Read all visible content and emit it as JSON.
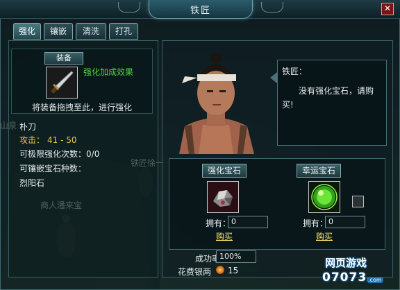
{
  "window": {
    "title": "铁匠",
    "close_label": "✕"
  },
  "tabs": [
    {
      "label": "强化",
      "active": true
    },
    {
      "label": "镶嵌",
      "active": false
    },
    {
      "label": "清洗",
      "active": false
    },
    {
      "label": "打孔",
      "active": false
    }
  ],
  "equip": {
    "section_label": "装备",
    "effect_text": "强化加成效果",
    "drag_hint": "将装备拖拽至此，进行强化"
  },
  "item": {
    "name": "朴刀",
    "attack_label": "攻击：",
    "attack_value": "41 - 50",
    "max_enhance_label": "可极限强化次数：",
    "max_enhance_value": "0/0",
    "gem_kinds_label": "可镶嵌宝石种数：",
    "gem_name": "烈阳石"
  },
  "background_text": {
    "left_sign": "山泉",
    "npc_nearby": "铁匠徐一",
    "merchant": "商人潘来宝"
  },
  "npc": {
    "name": "铁匠：",
    "dialog": "没有强化宝石，请购买!"
  },
  "gems": {
    "enhance": {
      "label": "强化宝石",
      "own_label": "拥有：",
      "own_value": "0",
      "buy_label": "购买"
    },
    "lucky": {
      "label": "幸运宝石",
      "own_label": "拥有：",
      "own_value": "0",
      "buy_label": "购买",
      "checkbox_checked": false
    }
  },
  "footer": {
    "success_label": "成功率",
    "success_value": "100%",
    "cost_label": "花费银两",
    "cost_value": "15"
  },
  "watermark": {
    "line1": "网页游戏",
    "line2": "07073",
    "suffix": ".com"
  },
  "colors": {
    "accent_green": "#4fd63a",
    "buy_yellow": "#ffe46a",
    "stat_yellow": "#e6cc4a"
  }
}
